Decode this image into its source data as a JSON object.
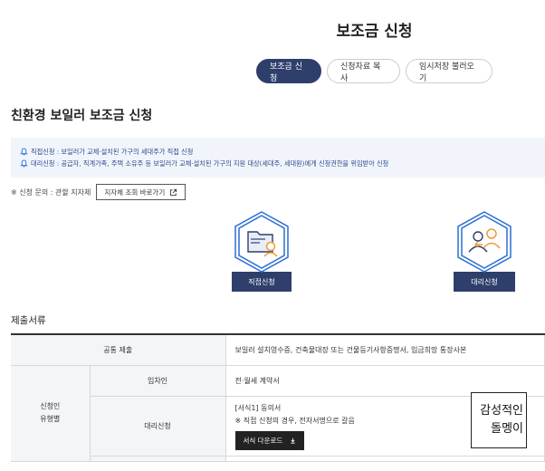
{
  "page": {
    "title": "보조금 신청"
  },
  "tabs": [
    {
      "label": "보조금 신청",
      "active": true
    },
    {
      "label": "신청자료 복사",
      "active": false
    },
    {
      "label": "임시저장 불러오기",
      "active": false
    }
  ],
  "section": {
    "title": "친환경 보일러 보조금 신청"
  },
  "notice": {
    "line1": "직접신청 : 보일러가 교체·설치된 가구의 세대주가 직접 신청",
    "line2": "대리신청 : 공급자, 직계가족, 주택 소유주 등 보일러가 교체·설치된 가구의 지원 대상(세대주, 세대원)에게 신청권한을 위임받아 신청"
  },
  "inquiry": {
    "text": "※ 신청 문의 : 관할 지자체",
    "button_label": "지자체 조회 바로가기"
  },
  "apply": {
    "direct_label": "직접신청",
    "proxy_label": "대리신청"
  },
  "docs": {
    "title": "제출서류",
    "common_header": "공통 제출",
    "common_value": "보일러 설치영수증, 건축물대장 또는 건물등기사항증명서, 입금희망 통장사본",
    "group_header_line1": "신청인",
    "group_header_line2": "유형별",
    "tenant_label": "임차인",
    "tenant_value": "전·월세 계약서",
    "proxy_label": "대리신청",
    "proxy_value_line1": "[서식1] 동의서",
    "proxy_value_line2": "※ 직접 신청의 경우, 전자서명으로 갈음",
    "download_label": "서식 다운로드"
  },
  "watermark": {
    "line1": "감성적인",
    "line2": "돌멩이"
  },
  "colors": {
    "primary": "#2f3f6b",
    "accent_blue": "#2b6fd1",
    "notice_bg": "#f1f5fb",
    "icon_orange": "#f29a36"
  }
}
